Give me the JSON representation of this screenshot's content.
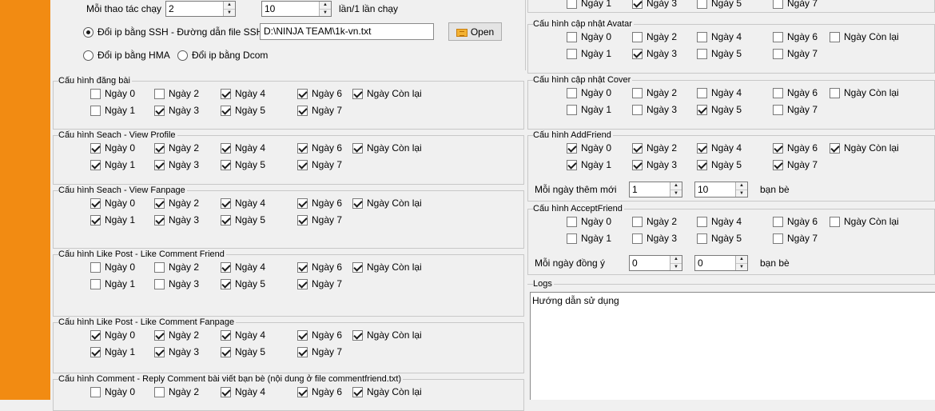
{
  "top": {
    "actions_label": "Mỗi thao tác chạy",
    "spin1": "2",
    "spin2": "10",
    "runs_label": "lần/1 lần chạy",
    "ip_ssh_label": "Đổi ip bằng SSH - Đường dẫn file SSH",
    "ssh_path": "D:\\NINJA TEAM\\1k-vn.txt",
    "open_button": "Open",
    "ip_hma_label": "Đổi ip bằng HMA",
    "ip_dcom_label": "Đổi ip bằng Dcom"
  },
  "days": {
    "d0": "Ngày 0",
    "d1": "Ngày 1",
    "d2": "Ngày 2",
    "d3": "Ngày 3",
    "d4": "Ngày 4",
    "d5": "Ngày 5",
    "d6": "Ngày 6",
    "d7": "Ngày 7",
    "rest": "Ngày Còn lại"
  },
  "left_sections": [
    {
      "title": "Cấu hình đăng bài",
      "checked": {
        "d0": false,
        "d1": false,
        "d2": false,
        "d3": true,
        "d4": true,
        "d5": true,
        "d6": true,
        "d7": true,
        "rest": true
      }
    },
    {
      "title": "Cấu hình Seach - View Profile",
      "checked": {
        "d0": true,
        "d1": true,
        "d2": true,
        "d3": true,
        "d4": true,
        "d5": true,
        "d6": true,
        "d7": true,
        "rest": true
      }
    },
    {
      "title": "Cấu hình Seach - View Fanpage",
      "checked": {
        "d0": true,
        "d1": true,
        "d2": true,
        "d3": true,
        "d4": true,
        "d5": true,
        "d6": true,
        "d7": true,
        "rest": true
      }
    },
    {
      "title": "Cấu hình Like Post - Like Comment Friend",
      "checked": {
        "d0": false,
        "d1": false,
        "d2": false,
        "d3": false,
        "d4": true,
        "d5": true,
        "d6": true,
        "d7": true,
        "rest": true
      }
    },
    {
      "title": "Cấu hình Like Post - Like Comment Fanpage",
      "checked": {
        "d0": true,
        "d1": true,
        "d2": true,
        "d3": true,
        "d4": true,
        "d5": true,
        "d6": true,
        "d7": true,
        "rest": true
      }
    },
    {
      "title": "Cấu hình Comment - Reply Comment bài viết bạn bè (nội dung ở file commentfriend.txt)",
      "checked": {
        "d0": false,
        "d2": false,
        "d4": true,
        "d6": true,
        "rest": true
      }
    }
  ],
  "right_top_partial": {
    "checked": {
      "d1": false,
      "d3": true,
      "d5": false,
      "d7": false
    }
  },
  "right_sections": [
    {
      "title": "Cấu hình cập nhật Avatar",
      "checked": {
        "d0": false,
        "d1": false,
        "d2": false,
        "d3": true,
        "d4": false,
        "d5": false,
        "d6": false,
        "d7": false,
        "rest": false
      }
    },
    {
      "title": "Cấu hình cập nhật Cover",
      "checked": {
        "d0": false,
        "d1": false,
        "d2": false,
        "d3": false,
        "d4": false,
        "d5": true,
        "d6": false,
        "d7": false,
        "rest": false
      }
    },
    {
      "title": "Cấu hình AddFriend",
      "checked": {
        "d0": true,
        "d1": true,
        "d2": true,
        "d3": true,
        "d4": true,
        "d5": true,
        "d6": true,
        "d7": true,
        "rest": true
      },
      "extra_label": "Mỗi ngày thêm mới",
      "spin_a": "1",
      "spin_b": "10",
      "unit": "bạn bè"
    },
    {
      "title": "Cấu hình AcceptFriend",
      "checked": {
        "d0": false,
        "d1": false,
        "d2": false,
        "d3": false,
        "d4": false,
        "d5": false,
        "d6": false,
        "d7": false,
        "rest": false
      },
      "extra_label": "Mỗi ngày đồng ý",
      "spin_a": "0",
      "spin_b": "0",
      "unit": "bạn bè"
    }
  ],
  "logs": {
    "title": "Logs",
    "content": "Hướng dẫn sử dụng"
  }
}
